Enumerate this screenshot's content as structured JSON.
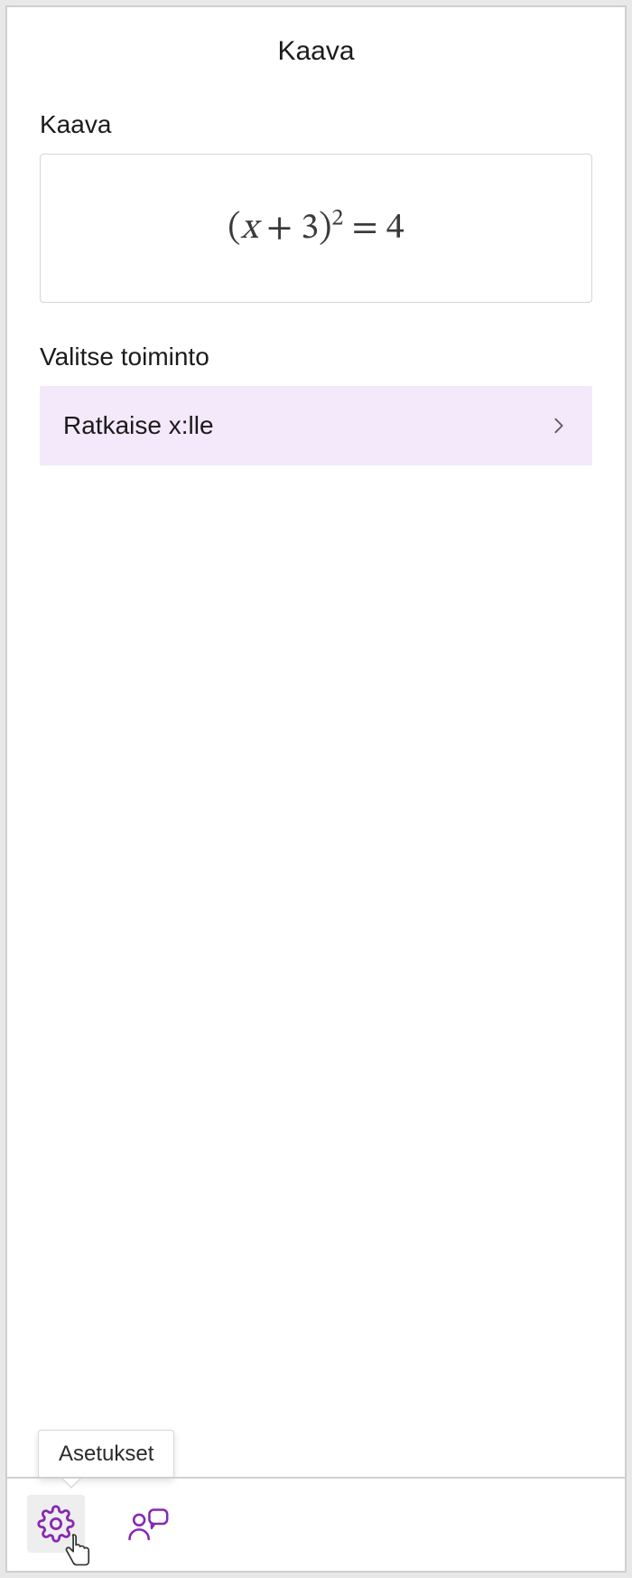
{
  "header": {
    "title": "Kaava"
  },
  "formula_section": {
    "label": "Kaava",
    "equation_display": "(x + 3)² = 4"
  },
  "action_section": {
    "label": "Valitse toiminto",
    "items": [
      {
        "label": "Ratkaise x:lle"
      }
    ]
  },
  "footer": {
    "settings_tooltip": "Asetukset",
    "icons": {
      "settings": "gear-icon",
      "feedback": "person-chat-icon"
    }
  },
  "colors": {
    "accent": "#8827b3",
    "action_bg": "#f3e9fb"
  }
}
